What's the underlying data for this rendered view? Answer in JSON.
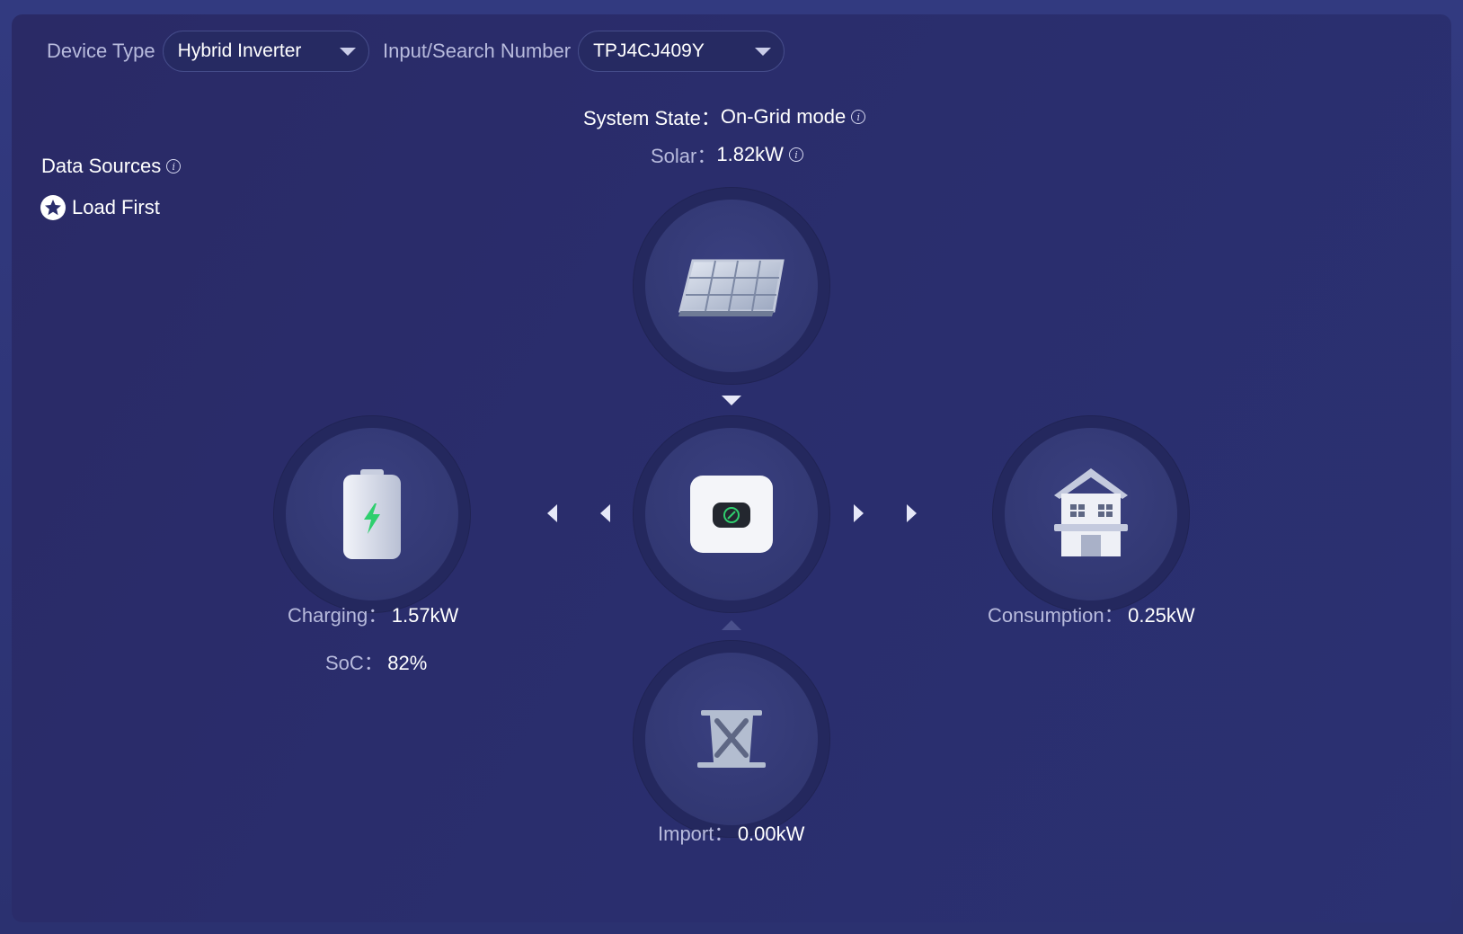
{
  "filters": {
    "device_type_label": "Device Type",
    "device_type_value": "Hybrid Inverter",
    "search_label": "Input/Search Number",
    "search_value": "TPJ4CJ409Y"
  },
  "system": {
    "state_label": "System State：",
    "state_value": "On-Grid mode",
    "solar_label": "Solar：",
    "solar_value": "1.82kW"
  },
  "data_sources": {
    "title": "Data Sources",
    "mode": "Load First"
  },
  "battery": {
    "charging_label": "Charging：",
    "charging_value": "1.57kW",
    "soc_label": "SoC：",
    "soc_value": "82%"
  },
  "consumption": {
    "label": "Consumption：",
    "value": "0.25kW"
  },
  "grid": {
    "label": "Import：",
    "value": "0.00kW"
  },
  "icons": {
    "solar": "solar-panel-icon",
    "inverter": "inverter-icon",
    "battery": "battery-icon",
    "house": "house-icon",
    "grid": "power-tower-icon"
  },
  "colors": {
    "accent_green": "#2fcf6e",
    "background": "#2a2d6c"
  }
}
